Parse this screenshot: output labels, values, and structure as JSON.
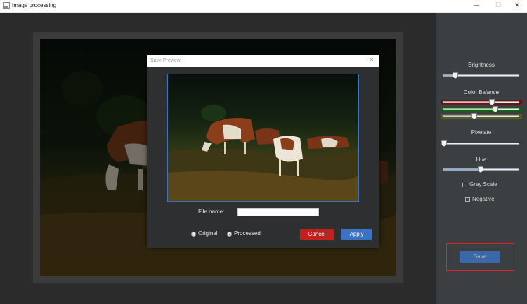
{
  "window": {
    "title": "Image processing",
    "controls": {
      "minimize": "—",
      "maximize": "☐",
      "close": "✕"
    }
  },
  "sidebar": {
    "brightness": {
      "label": "Brightness",
      "value": 0.15
    },
    "color_balance": {
      "label": "Color Balance",
      "red": 0.63,
      "green": 0.68,
      "blue": 0.4,
      "colors": {
        "red": "#6d1414",
        "green": "#146014",
        "blue": "#5a5a1a"
      }
    },
    "pixelate": {
      "label": "Pixelate",
      "value": 0.0
    },
    "hue": {
      "label": "Hue",
      "value": 0.48
    },
    "gray_scale": {
      "label": "Gray Scale",
      "checked": false
    },
    "negative": {
      "label": "Negative",
      "checked": false
    },
    "save_label": "Save",
    "accent": "#3a67a8",
    "highlight_color": "#d9262a"
  },
  "dialog": {
    "title": "Save Preview",
    "close_icon": "✕",
    "file_name_label": "File name:",
    "file_name_value": "",
    "radio_original": "Original",
    "radio_processed": "Processed",
    "selected": "processed",
    "cancel_label": "Cancel",
    "apply_label": "Apply",
    "cancel_color": "#c2221f",
    "apply_color": "#3c72c6"
  }
}
